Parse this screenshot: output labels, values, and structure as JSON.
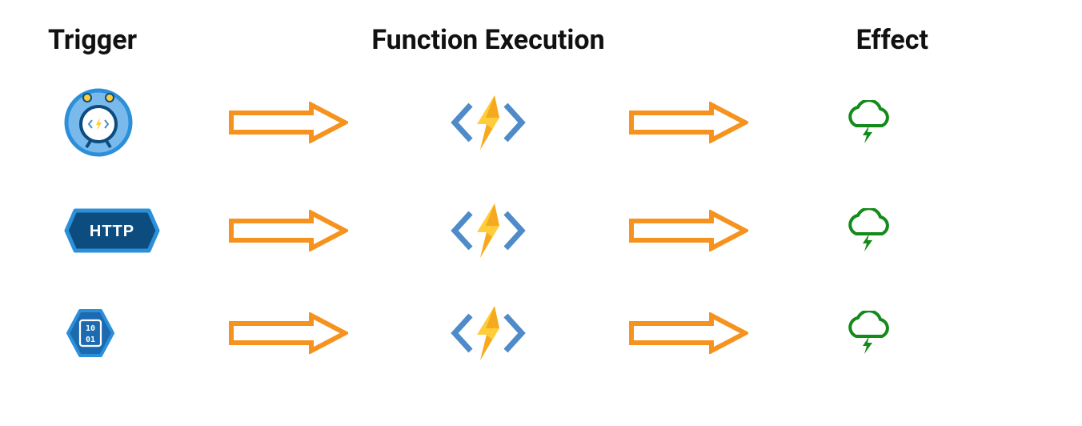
{
  "headers": {
    "trigger": "Trigger",
    "function": "Function Execution",
    "effect": "Effect"
  },
  "rows": [
    {
      "trigger_type": "timer",
      "trigger_label": "Timer",
      "effect_label": "Cloud"
    },
    {
      "trigger_type": "http",
      "trigger_label": "HTTP",
      "effect_label": "Cloud"
    },
    {
      "trigger_type": "binary",
      "trigger_label": "Binary",
      "effect_label": "Cloud"
    }
  ],
  "icons": {
    "http_text": "HTTP",
    "binary_text_top": "10",
    "binary_text_bottom": "01"
  },
  "colors": {
    "arrow": "#F6921E",
    "func_bracket": "#4E8BC8",
    "func_bolt_light": "#FFCD3A",
    "func_bolt_dark": "#F6921E",
    "cloud": "#138A19",
    "timer_outer": "#2B8FD9",
    "timer_inner": "#79B9EC",
    "http_fill": "#0C4C7F",
    "http_border": "#2B8FD9",
    "binary_fill": "#1C6BB0",
    "binary_border": "#2B8FD9"
  }
}
